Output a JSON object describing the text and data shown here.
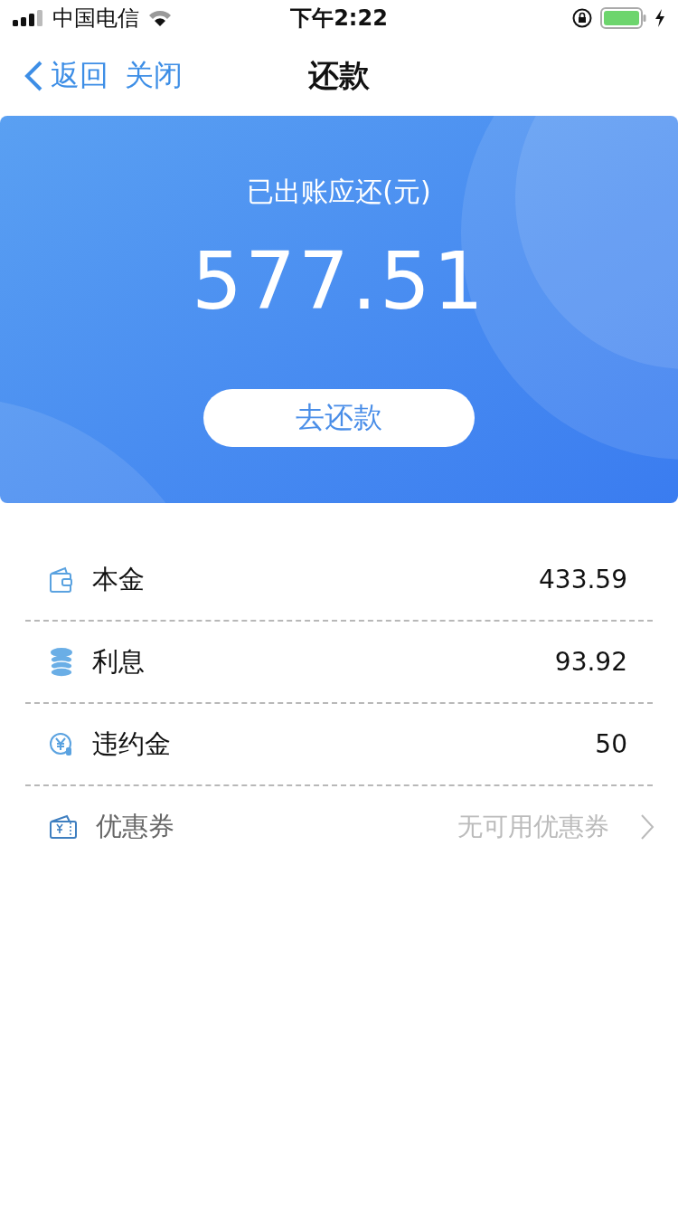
{
  "status_bar": {
    "carrier": "中国电信",
    "time": "下午2:22"
  },
  "nav": {
    "back": "返回",
    "close": "关闭",
    "title": "还款"
  },
  "hero": {
    "label": "已出账应还(元)",
    "amount": "577.51",
    "button": "去还款"
  },
  "rows": [
    {
      "kind": "amount",
      "label": "本金",
      "value": "433.59"
    },
    {
      "kind": "amount",
      "label": "利息",
      "value": "93.92"
    },
    {
      "kind": "amount",
      "label": "违约金",
      "value": "50"
    },
    {
      "kind": "link",
      "label": "优惠券",
      "value": "无可用优惠券"
    }
  ]
}
